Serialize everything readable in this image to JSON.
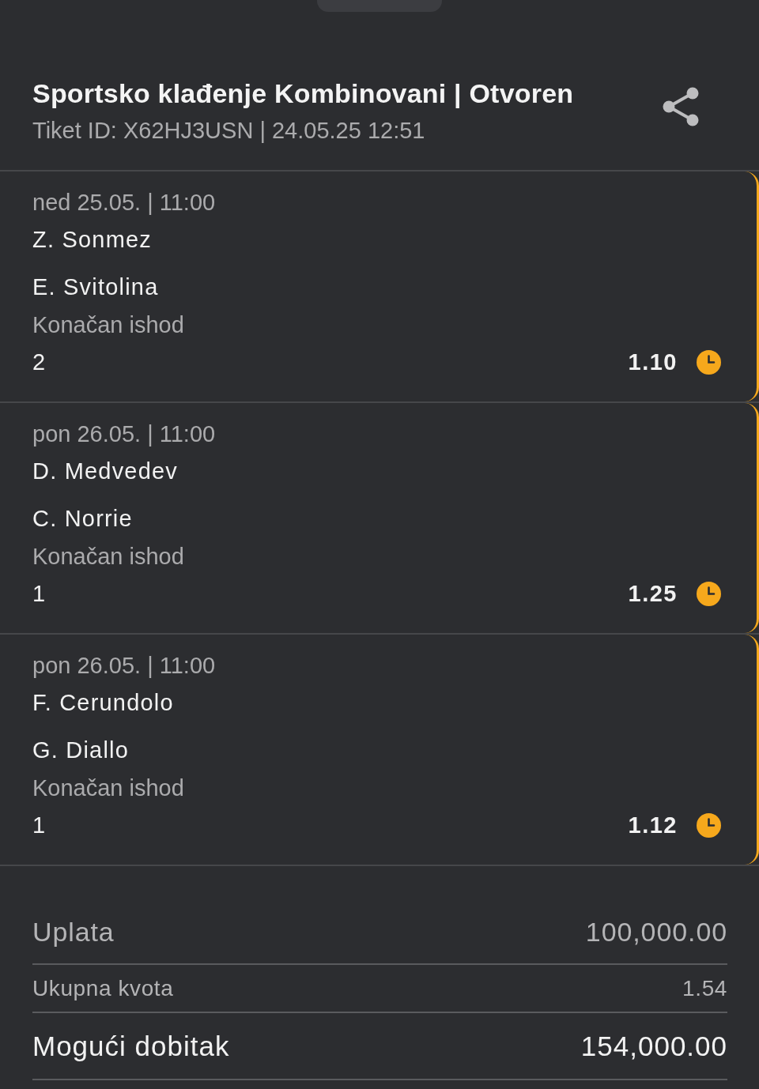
{
  "header": {
    "title": "Sportsko klađenje Kombinovani | Otvoren",
    "subtitle": "Tiket ID: X62HJ3USN | 24.05.25 12:51"
  },
  "events": [
    {
      "datetime": "ned 25.05. | 11:00",
      "home": "Z. Sonmez",
      "away": "E. Svitolina",
      "market": "Konačan ishod",
      "pick": "2",
      "odds": "1.10",
      "pending": true
    },
    {
      "datetime": "pon 26.05. | 11:00",
      "home": "D. Medvedev",
      "away": "C. Norrie",
      "market": "Konačan ishod",
      "pick": "1",
      "odds": "1.25",
      "pending": true
    },
    {
      "datetime": "pon 26.05. | 11:00",
      "home": "F. Cerundolo",
      "away": "G. Diallo",
      "market": "Konačan ishod",
      "pick": "1",
      "odds": "1.12",
      "pending": true
    }
  ],
  "summary": [
    {
      "kind": "stake",
      "label": "Uplata",
      "value": "100,000.00"
    },
    {
      "kind": "odds",
      "label": "Ukupna kvota",
      "value": "1.54"
    },
    {
      "kind": "win",
      "label": "Mogući dobitak",
      "value": "154,000.00"
    }
  ]
}
